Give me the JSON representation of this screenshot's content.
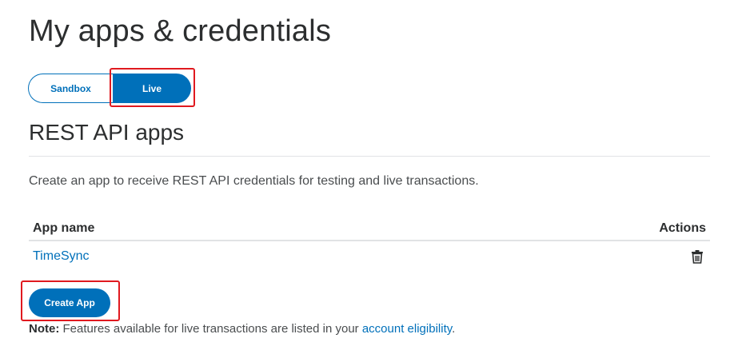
{
  "page": {
    "title": "My apps & credentials"
  },
  "environment_toggle": {
    "options": [
      {
        "label": "Sandbox",
        "selected": false
      },
      {
        "label": "Live",
        "selected": true
      }
    ]
  },
  "section": {
    "title": "REST API apps",
    "description": "Create an app to receive REST API credentials for testing and live transactions."
  },
  "apps_table": {
    "columns": [
      "App name",
      "Actions"
    ],
    "rows": [
      {
        "app_name": "TimeSync",
        "actions": [
          "trash-icon"
        ]
      }
    ]
  },
  "create_button": {
    "label": "Create App"
  },
  "note": {
    "label": "Note:",
    "text": " Features available for live transactions are listed in your ",
    "link_text": "account eligibility",
    "suffix": "."
  },
  "colors": {
    "accent": "#0070ba",
    "highlight": "#e0191f",
    "text": "#2c2e2f"
  }
}
